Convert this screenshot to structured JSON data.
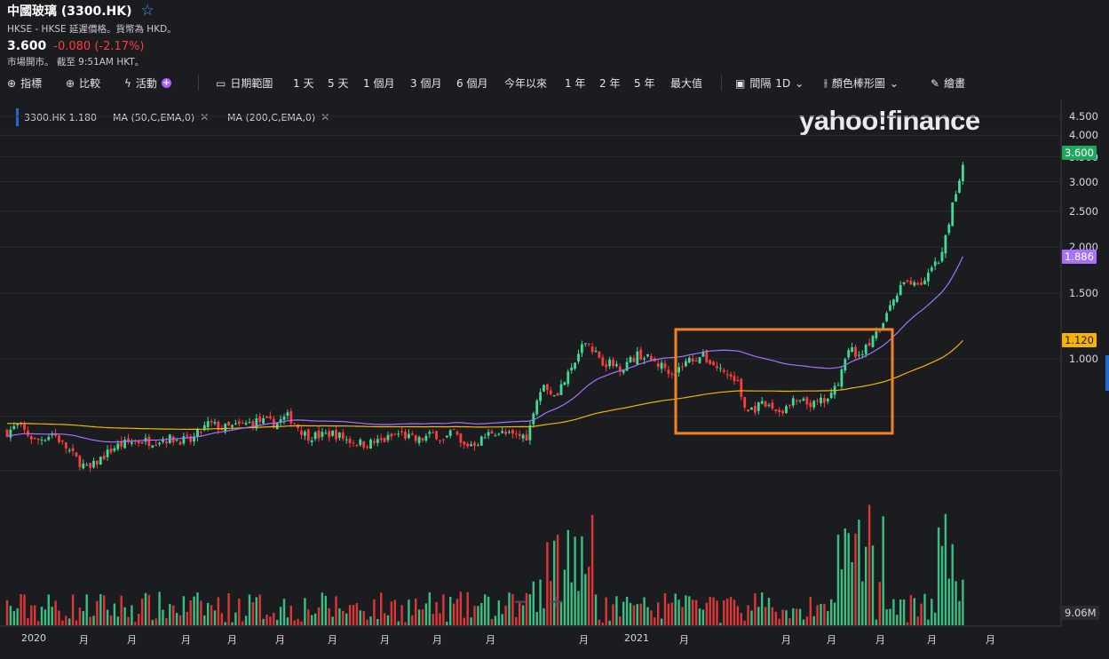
{
  "header": {
    "title": "中國玻璃 (3300.HK)",
    "exchange_note": "HKSE - HKSE 延遲價格。貨幣為 HKD。",
    "price": "3.600",
    "change": "-0.080 (-2.17%)",
    "market_status": "市場開市。 截至 9:51AM HKT。"
  },
  "toolbar": {
    "indicators": "指標",
    "compare": "比較",
    "events": "活動",
    "date_range": "日期範圍",
    "ranges": [
      "1 天",
      "5 天",
      "1 個月",
      "3 個月",
      "6 個月",
      "今年以來",
      "1 年",
      "2 年",
      "5 年",
      "最大值"
    ],
    "interval": "間隔",
    "interval_value": "1D",
    "chart_style": "顏色棒形圖",
    "draw": "繪畫"
  },
  "legend": {
    "symbol_tag": "3300.HK 1.180",
    "ma50_tag": "MA (50,C,EMA,0)",
    "ma200_tag": "MA (200,C,EMA,0)"
  },
  "logo_text": "yahoo!finance",
  "colors": {
    "background": "#1b1c1f",
    "up": "#3ddc97",
    "down": "#ff3b3b",
    "ma50": "#a671ff",
    "ma200": "#f4b400",
    "highlight_box": "#f58220",
    "price_badge": "#1fa85b"
  },
  "chart_data": {
    "type": "candlestick",
    "price_scale": "log",
    "ylim": [
      0.3,
      4.6
    ],
    "y_ticks": [
      "4.500",
      "4.000",
      "3.500",
      "3.000",
      "2.500",
      "2.000",
      "1.500",
      "1.000"
    ],
    "y_badges": {
      "last_price": "3.600",
      "ma50": "1.886",
      "ma200": "1.120",
      "volume": "9.06M"
    },
    "x_labels": [
      "2020",
      "月",
      "月",
      "月",
      "月",
      "月",
      "月",
      "月",
      "月",
      "月",
      "月",
      "2021",
      "月",
      "月",
      "月",
      "月",
      "月",
      "月"
    ],
    "series": [
      {
        "name": "3300.HK",
        "close_start": 0.62,
        "close_end": 3.6
      },
      {
        "name": "MA (50,C,EMA,0)",
        "last": 1.886
      },
      {
        "name": "MA (200,C,EMA,0)",
        "last": 1.12
      }
    ],
    "highlight_range": {
      "y_low": 0.63,
      "y_high": 1.2
    },
    "grid": true
  }
}
